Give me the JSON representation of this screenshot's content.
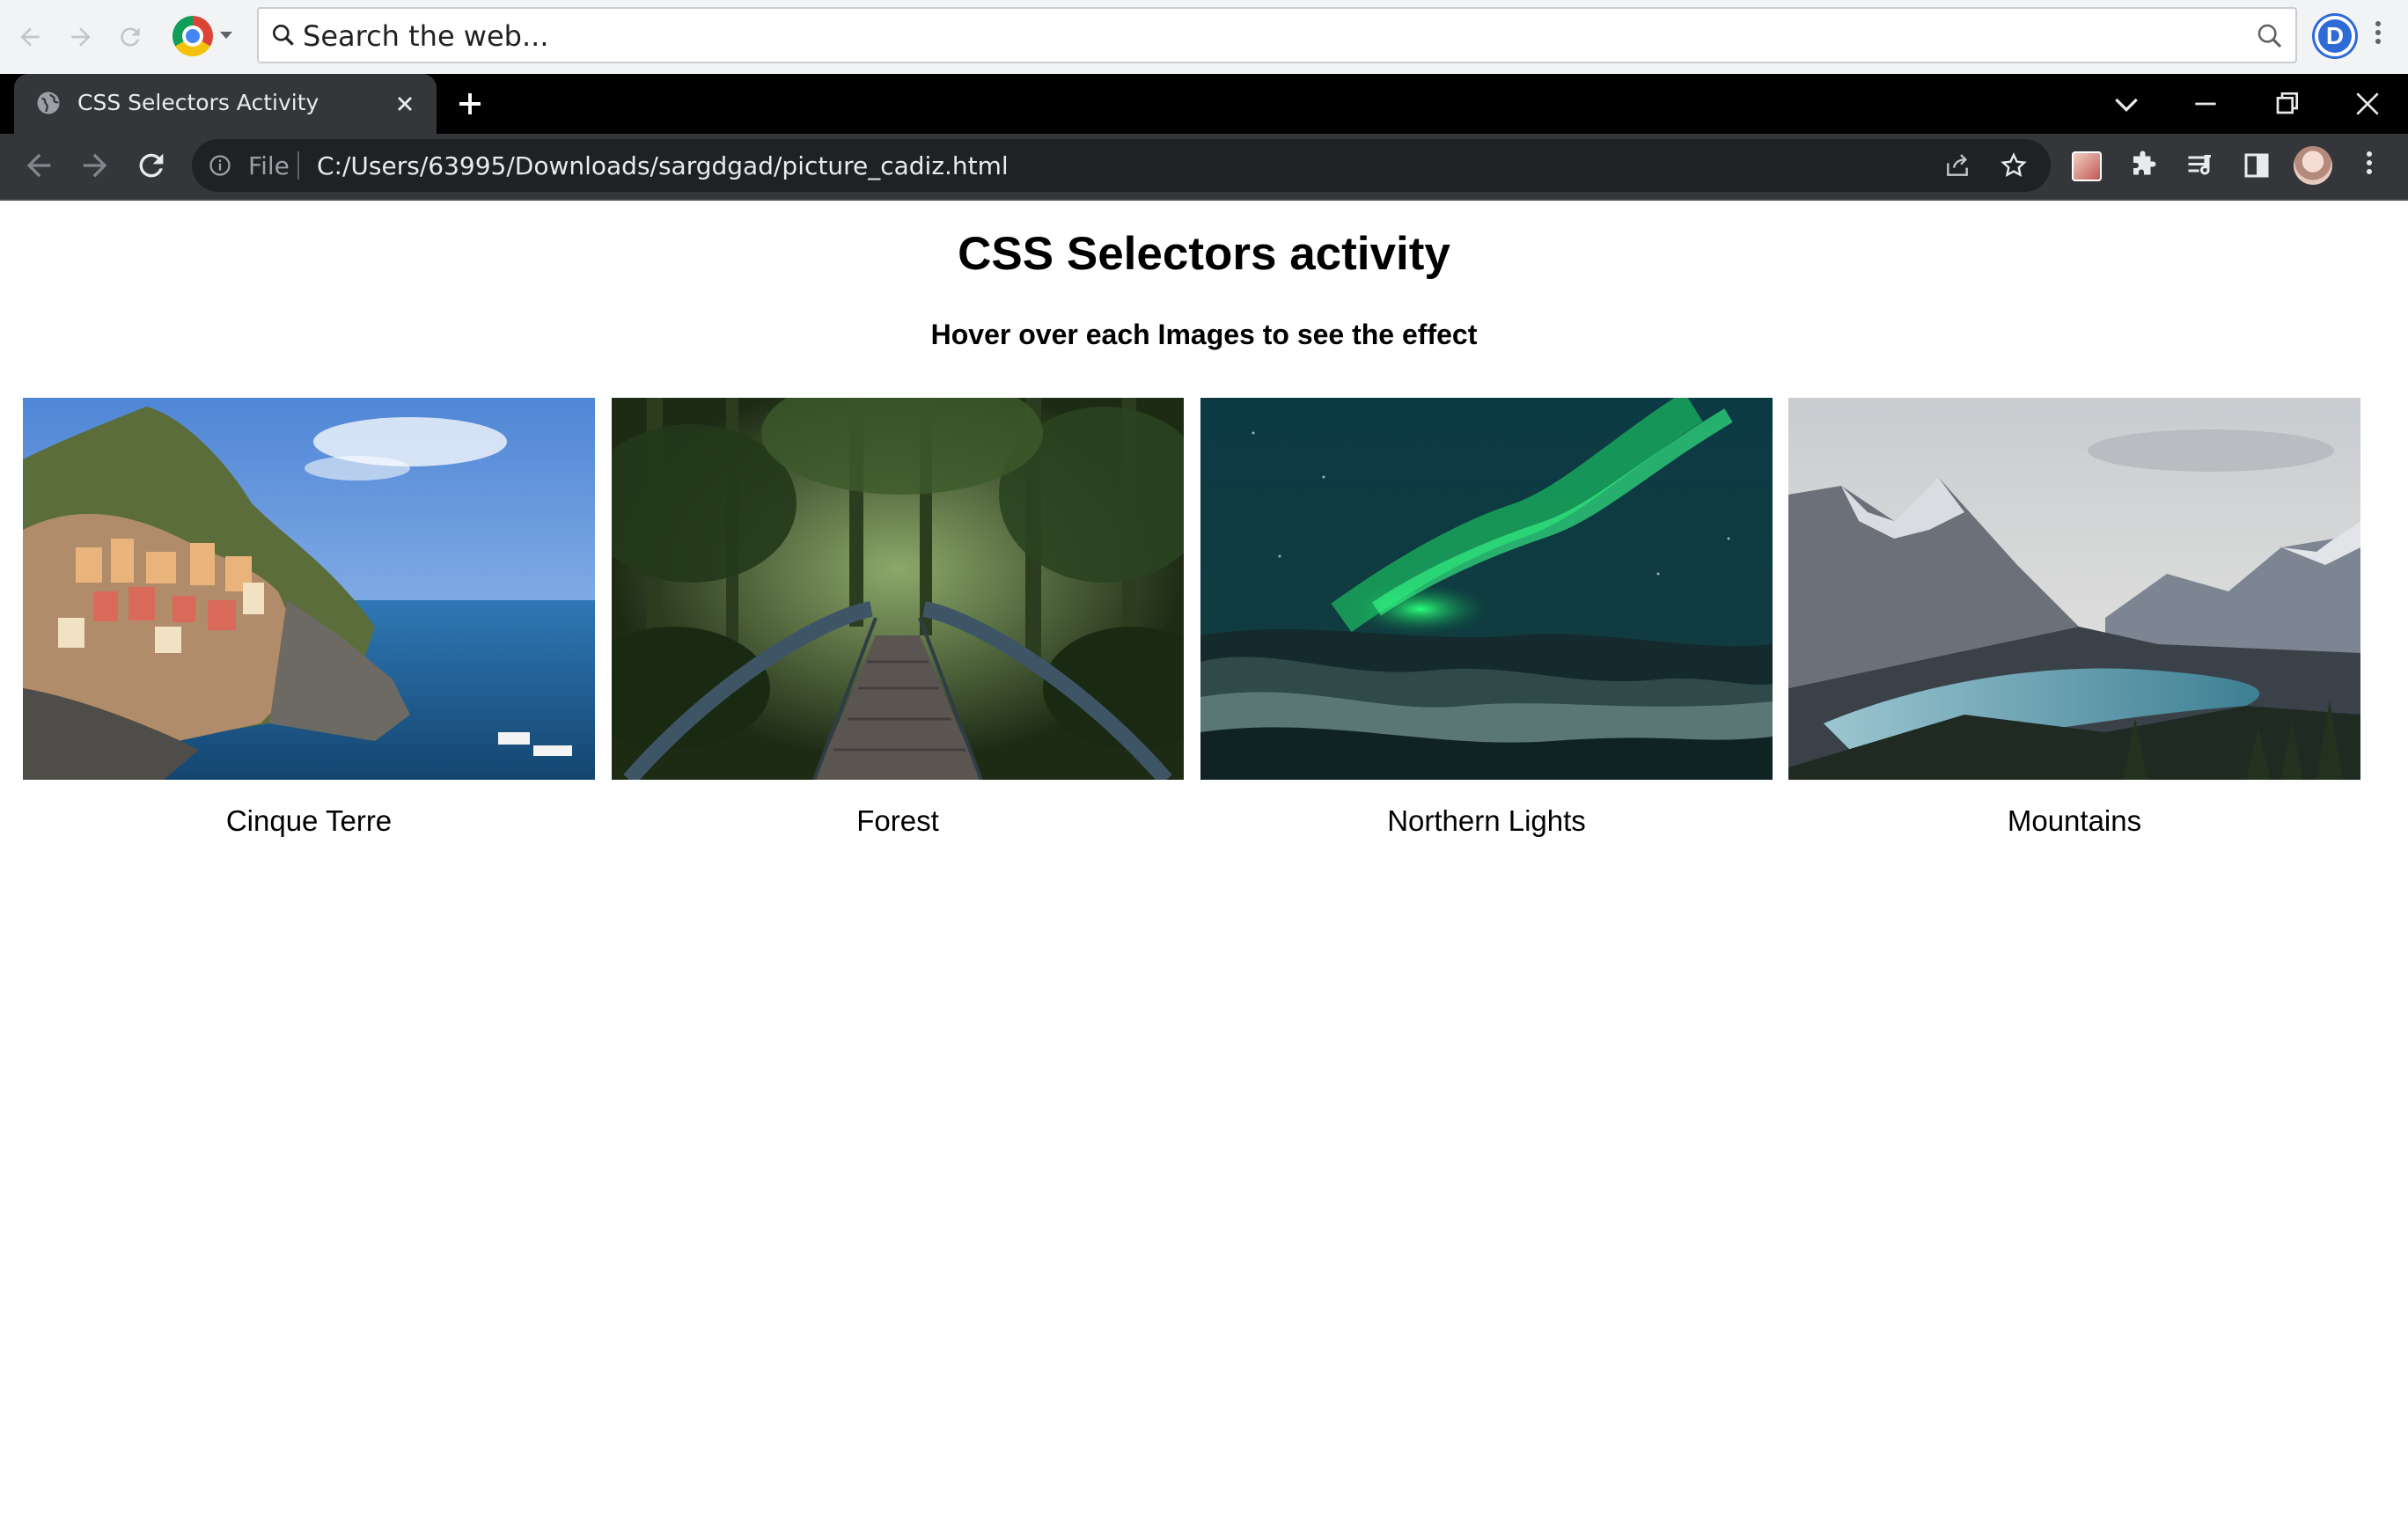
{
  "search_bar": {
    "placeholder": "Search the web..."
  },
  "tab": {
    "title": "CSS Selectors Activity"
  },
  "omnibox": {
    "scheme_label": "File",
    "url": "C:/Users/63995/Downloads/sargdgad/picture_cadiz.html"
  },
  "profile": {
    "initial": "D"
  },
  "page": {
    "title": "CSS Selectors activity",
    "subtitle": "Hover over each Images to see the effect"
  },
  "gallery": [
    {
      "caption": "Cinque Terre",
      "image": "coastal-village"
    },
    {
      "caption": "Forest",
      "image": "forest-bridge"
    },
    {
      "caption": "Northern Lights",
      "image": "aurora"
    },
    {
      "caption": "Mountains",
      "image": "mountain-lake"
    }
  ],
  "colors": {
    "tab_strip": "#000000",
    "toolbar": "#35363a",
    "omnibox": "#202124",
    "page_background": "#ffffff",
    "text": "#000000"
  }
}
